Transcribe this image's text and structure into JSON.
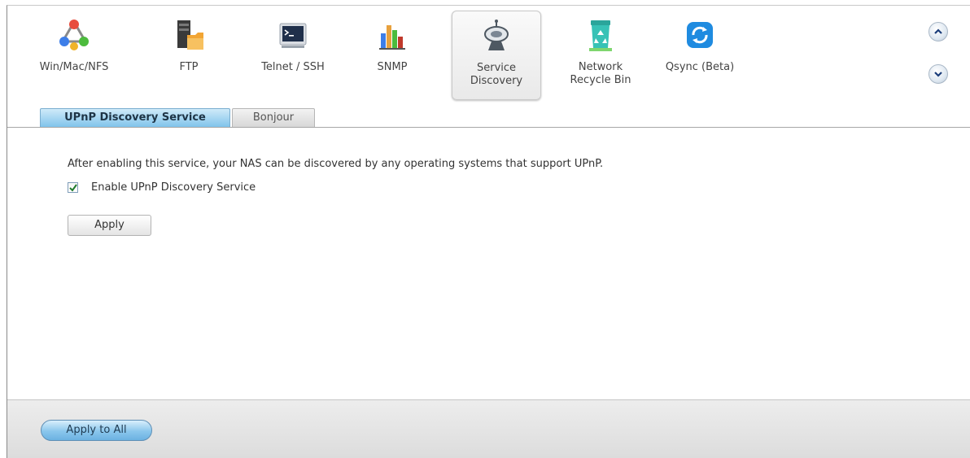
{
  "services": [
    {
      "id": "win-mac-nfs",
      "label": "Win/Mac/NFS",
      "icon": "network-share-icon"
    },
    {
      "id": "ftp",
      "label": "FTP",
      "icon": "ftp-server-icon"
    },
    {
      "id": "telnet-ssh",
      "label": "Telnet / SSH",
      "icon": "terminal-icon"
    },
    {
      "id": "snmp",
      "label": "SNMP",
      "icon": "bar-chart-icon"
    },
    {
      "id": "service-discovery",
      "label": "Service\nDiscovery",
      "icon": "satellite-dish-icon",
      "active": true
    },
    {
      "id": "network-recycle-bin",
      "label": "Network\nRecycle Bin",
      "icon": "recycle-bin-icon"
    },
    {
      "id": "qsync",
      "label": "Qsync (Beta)",
      "icon": "sync-icon"
    }
  ],
  "tabs": {
    "active": "UPnP Discovery Service",
    "inactive": "Bonjour"
  },
  "content": {
    "description": "After enabling this service, your NAS can be discovered by any operating systems that support UPnP.",
    "checkbox_label": "Enable UPnP Discovery Service",
    "checkbox_checked": true,
    "apply_label": "Apply"
  },
  "footer": {
    "apply_all_label": "Apply to All"
  },
  "colors": {
    "active_tab": "#7dc2ea",
    "apply_all": "#8ac6ec"
  }
}
